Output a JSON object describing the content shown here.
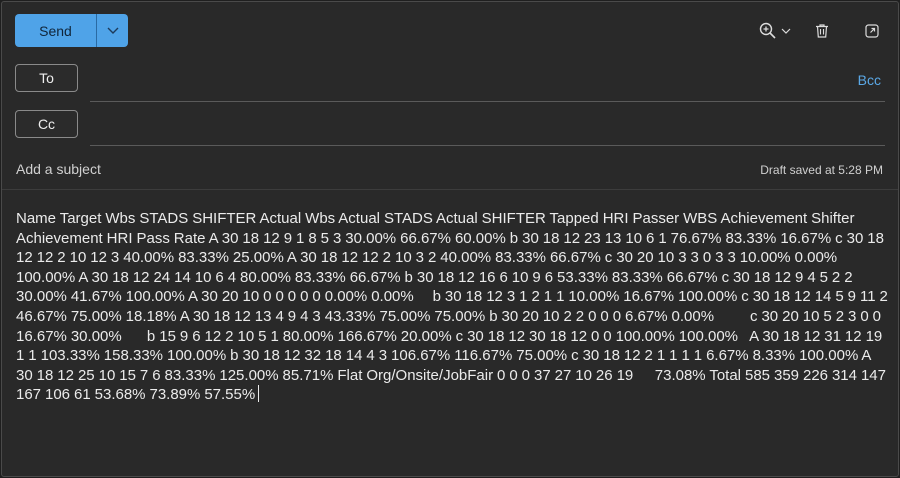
{
  "toolbar": {
    "send_label": "Send",
    "send_options_icon": "chevron-down-icon",
    "zoom_icon": "zoom-in-icon",
    "delete_icon": "trash-icon",
    "popout_icon": "popout-icon"
  },
  "recipients": {
    "to_label": "To",
    "cc_label": "Cc",
    "bcc_label": "Bcc",
    "to_value": "",
    "cc_value": ""
  },
  "subject": {
    "placeholder": "Add a subject",
    "value": ""
  },
  "status": {
    "draft_saved": "Draft saved at 5:28 PM"
  },
  "body": {
    "text": "Name Target Wbs STADS SHIFTER Actual Wbs Actual STADS Actual SHIFTER Tapped HRI Passer WBS Achievement Shifter Achievement HRI Pass Rate A 30 18 12 9 1 8 5 3 30.00% 66.67% 60.00% b 30 18 12 23 13 10 6 1 76.67% 83.33% 16.67% c 30 18 12 12 2 10 12 3 40.00% 83.33% 25.00% A 30 18 12 12 2 10 3 2 40.00% 83.33% 66.67% c 30 20 10 3 3 0 3 3 10.00% 0.00% 100.00% A 30 18 12 24 14 10 6 4 80.00% 83.33% 66.67% b 30 18 12 16 6 10 9 6 53.33% 83.33% 66.67% c 30 18 12 9 4 5 2 2 30.00% 41.67% 100.00% A 30 20 10 0 0 0 0 0 0.00% 0.00%\t b 30 18 12 3 1 2 1 1 10.00% 16.67% 100.00% c 30 18 12 14 5 9 11 2 46.67% 75.00% 18.18% A 30 18 12 13 4 9 4 3 43.33% 75.00% 75.00% b 30 20 10 2 2 0 0 0 6.67% 0.00%\t c 30 20 10 5 2 3 0 0 16.67% 30.00%\t b 15 9 6 12 2 10 5 1 80.00% 166.67% 20.00% c 30 18 12 30 18 12 0 0 100.00% 100.00%\t A 30 18 12 31 12 19 1 1 103.33% 158.33% 100.00% b 30 18 12 32 18 14 4 3 106.67% 116.67% 75.00% c 30 18 12 2 1 1 1 1 6.67% 8.33% 100.00% A 30 18 12 25 10 15 7 6 83.33% 125.00% 85.71% Flat Org/Onsite/JobFair 0 0 0 37 27 10 26 19\t 73.08% Total 585 359 226 314 147 167 106 61 53.68% 73.89% 57.55%"
  },
  "colors": {
    "accent": "#4fa3e8",
    "link": "#5aa8e6",
    "background": "#292929",
    "text": "#ebebeb"
  }
}
